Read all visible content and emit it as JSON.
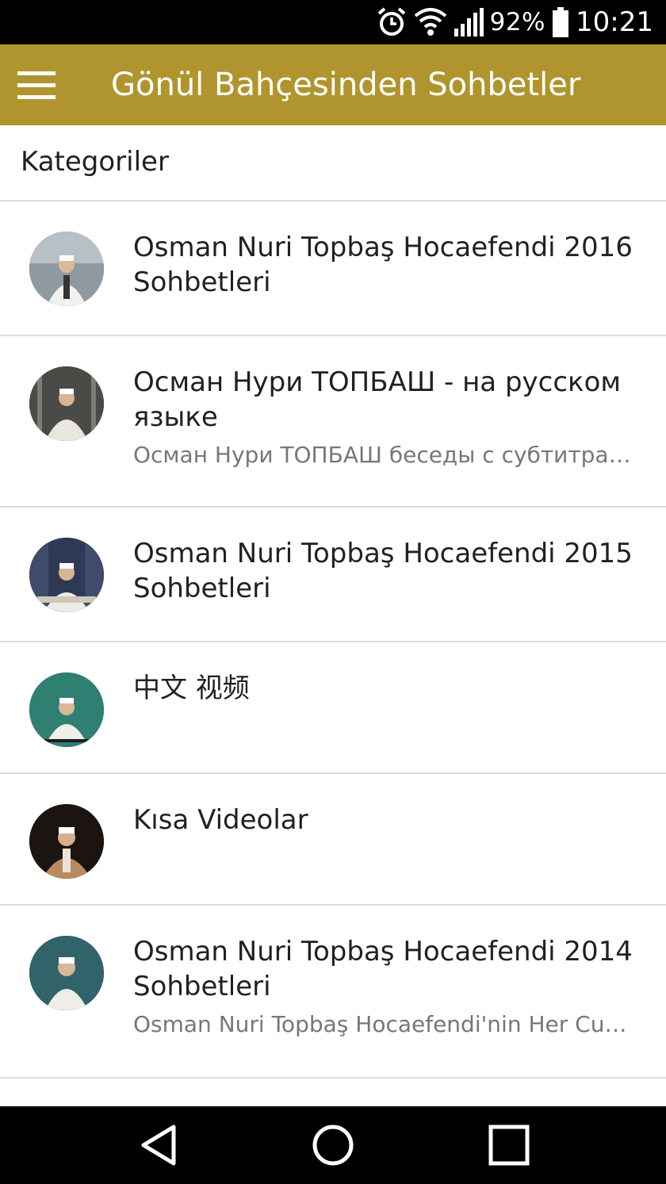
{
  "status_bar": {
    "battery_percent": "92%",
    "time": "10:21",
    "icons": [
      "alarm-icon",
      "wifi-icon",
      "signal-icon",
      "battery-icon"
    ]
  },
  "app_bar": {
    "title": "Gönül Bahçesinden Sohbetler",
    "background_color": "#B0952E",
    "menu_icon": "hamburger-menu-icon"
  },
  "section": {
    "title": "Kategoriler"
  },
  "categories": [
    {
      "title": "Osman Nuri Topbaş Hocaefendi 2016 Sohbetleri",
      "subtitle": ""
    },
    {
      "title": "Осман Нури ТОПБАШ - на русском языке",
      "subtitle": "Осман Нури ТОПБАШ беседы с субтитрами"
    },
    {
      "title": "Osman Nuri Topbaş Hocaefendi 2015 Sohbetleri",
      "subtitle": ""
    },
    {
      "title": "中文 视频",
      "subtitle": ""
    },
    {
      "title": "Kısa Videolar",
      "subtitle": ""
    },
    {
      "title": "Osman Nuri Topbaş Hocaefendi 2014 Sohbetleri",
      "subtitle": "Osman Nuri Topbaş Hocaefendi'nin Her Cuma"
    }
  ],
  "nav_bar": {
    "buttons": [
      "back-icon",
      "home-icon",
      "recents-icon"
    ]
  }
}
